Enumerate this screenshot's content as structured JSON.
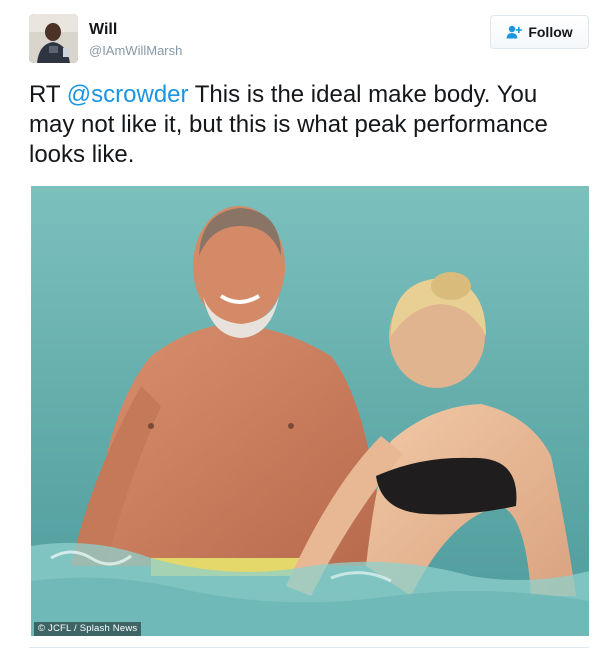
{
  "tweet": {
    "author": {
      "name": "Will",
      "handle": "@IAmWillMarsh"
    },
    "follow_button": {
      "label": "Follow",
      "icon": "add-user-icon",
      "accent_color": "#1b95e0"
    },
    "text": {
      "prefix": "RT ",
      "mention": "@scrowder",
      "body": " This is the ideal make body. You may not like it, but this is what peak performance looks like."
    },
    "media": {
      "credit": "© JCFL / Splash News"
    }
  }
}
